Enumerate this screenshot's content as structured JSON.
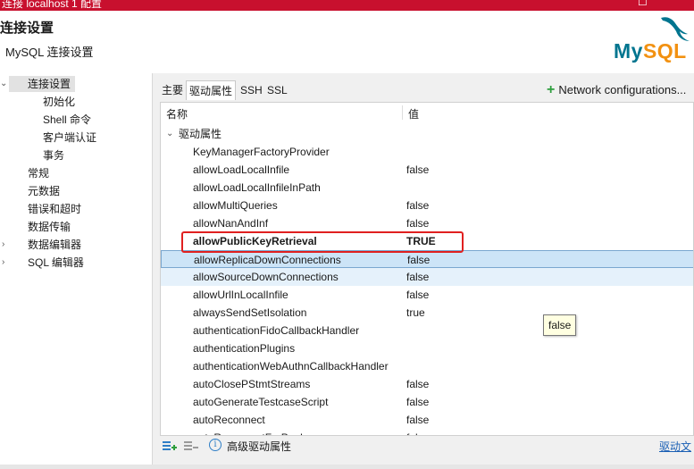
{
  "window": {
    "title": "连接 localhost 1 配置",
    "max_glyph": "☐"
  },
  "header": {
    "title": "连接设置",
    "subtitle": "MySQL 连接设置",
    "logo_my": "My",
    "logo_sql": "SQL"
  },
  "sidebar": {
    "items": [
      {
        "label": "连接设置",
        "chevron": "⌄"
      },
      {
        "label": "初始化"
      },
      {
        "label": "Shell 命令"
      },
      {
        "label": "客户端认证"
      },
      {
        "label": "事务"
      },
      {
        "label": "常规"
      },
      {
        "label": "元数据"
      },
      {
        "label": "错误和超时"
      },
      {
        "label": "数据传输"
      },
      {
        "label": "数据编辑器",
        "chevron": "›"
      },
      {
        "label": "SQL 编辑器",
        "chevron": "›"
      }
    ]
  },
  "tabs": [
    {
      "label": "主要"
    },
    {
      "label": "驱动属性"
    },
    {
      "label": "SSH"
    },
    {
      "label": "SSL"
    }
  ],
  "network_config": {
    "label": "Network configurations..."
  },
  "table": {
    "col_name": "名称",
    "col_value": "值",
    "group": "驱动属性",
    "rows": [
      {
        "name": "KeyManagerFactoryProvider",
        "value": ""
      },
      {
        "name": "allowLoadLocalInfile",
        "value": "false"
      },
      {
        "name": "allowLoadLocalInfileInPath",
        "value": ""
      },
      {
        "name": "allowMultiQueries",
        "value": "false"
      },
      {
        "name": "allowNanAndInf",
        "value": "false"
      },
      {
        "name": "allowPublicKeyRetrieval",
        "value": "TRUE"
      },
      {
        "name": "allowReplicaDownConnections",
        "value": "false"
      },
      {
        "name": "allowSourceDownConnections",
        "value": "false"
      },
      {
        "name": "allowUrlInLocalInfile",
        "value": "false"
      },
      {
        "name": "alwaysSendSetIsolation",
        "value": "true"
      },
      {
        "name": "authenticationFidoCallbackHandler",
        "value": ""
      },
      {
        "name": "authenticationPlugins",
        "value": ""
      },
      {
        "name": "authenticationWebAuthnCallbackHandler",
        "value": ""
      },
      {
        "name": "autoClosePStmtStreams",
        "value": "false"
      },
      {
        "name": "autoGenerateTestcaseScript",
        "value": "false"
      },
      {
        "name": "autoReconnect",
        "value": "false"
      },
      {
        "name": "autoReconnectForPools",
        "value": "false"
      }
    ]
  },
  "tooltip": {
    "text": "false"
  },
  "bottom": {
    "info_glyph": "i",
    "advanced_label": "高级驱动属性",
    "driver_doc_label": "驱动文"
  }
}
